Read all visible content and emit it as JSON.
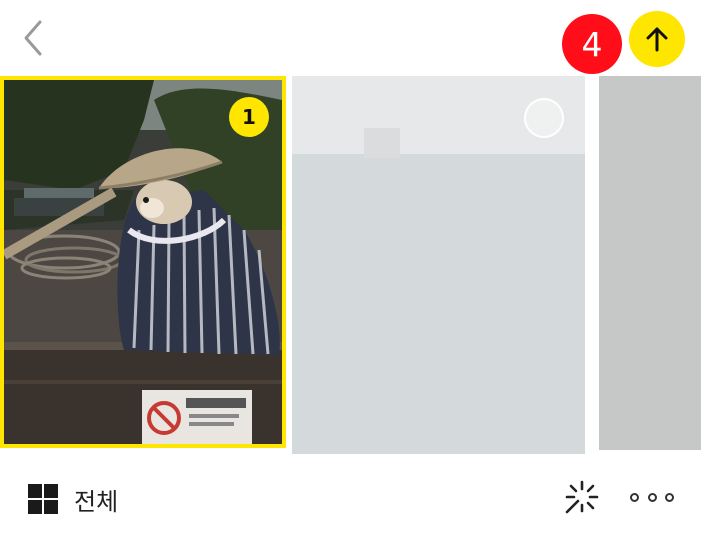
{
  "header": {
    "back_icon": "chevron-left-icon",
    "selected_count": "4",
    "send_icon": "arrow-up-icon"
  },
  "gallery": {
    "photos": [
      {
        "selected": true,
        "selection_number": "1"
      },
      {
        "selected": false
      },
      {
        "selected": false
      }
    ]
  },
  "footer": {
    "album_label": "전체",
    "album_icon": "grid-icon",
    "magic_icon": "sparkle-icon",
    "more_icon": "more-dots-icon"
  },
  "colors": {
    "accent": "#ffe600",
    "badge": "#ff0e19",
    "background": "#ffffff"
  }
}
